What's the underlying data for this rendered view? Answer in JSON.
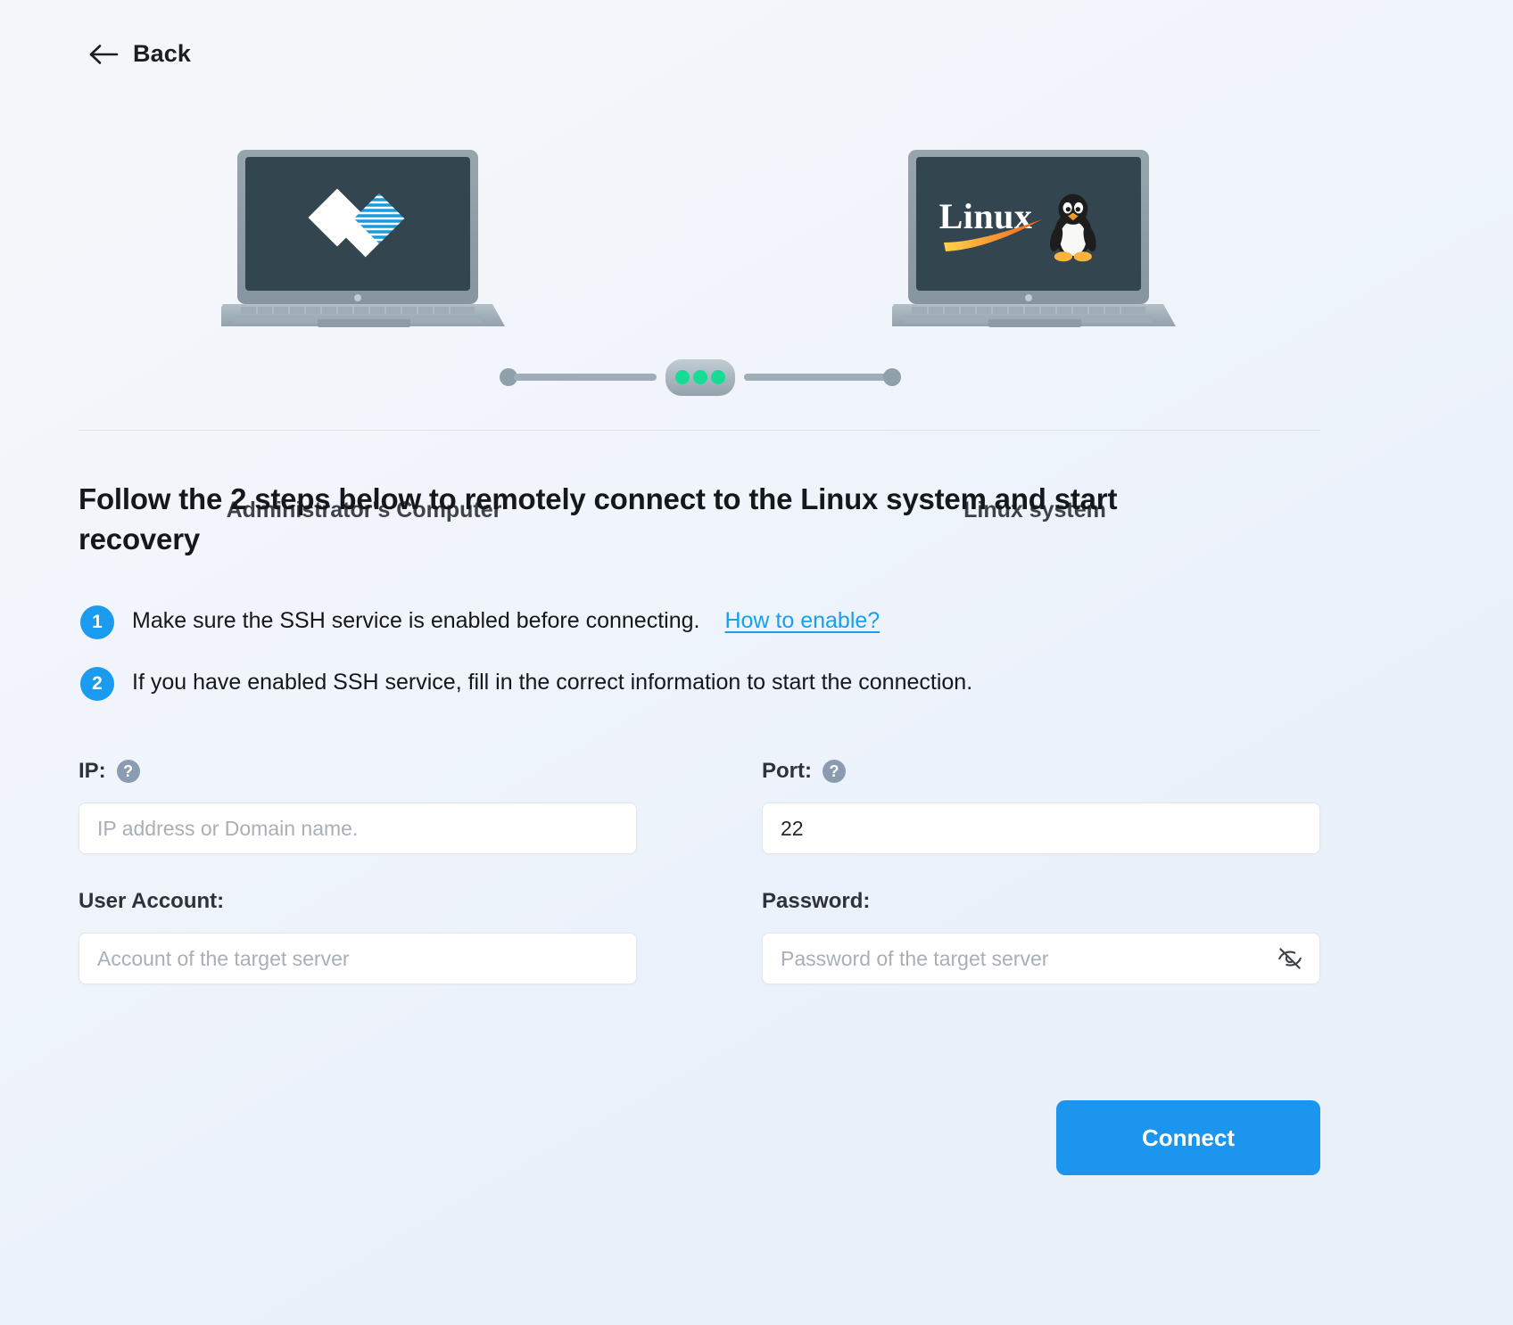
{
  "nav": {
    "back_label": "Back",
    "back_icon": "arrow-left-icon"
  },
  "illustration": {
    "left": {
      "caption": "Administrator's Computer",
      "screen_logo": "easeus-diamond-logo"
    },
    "right": {
      "caption": "Linux system",
      "screen_logo": "linux-tux-logo",
      "screen_logo_text": "Linux"
    },
    "connector": {
      "icon": "connection-status-pill",
      "dot_color": "#16dd93",
      "dots": 3
    }
  },
  "heading": "Follow the 2 steps below to remotely connect to the Linux system and start recovery",
  "steps": [
    {
      "number": "1",
      "text": "Make sure the SSH service is enabled before connecting.",
      "link": "How to enable?"
    },
    {
      "number": "2",
      "text": "If you have enabled SSH service, fill in the correct information to start the connection.",
      "link": ""
    }
  ],
  "form": {
    "ip": {
      "label": "IP:",
      "help_icon": "question-mark-icon",
      "value": "",
      "placeholder": "IP address or Domain name."
    },
    "port": {
      "label": "Port:",
      "help_icon": "question-mark-icon",
      "value": "22",
      "placeholder": "22"
    },
    "user_account": {
      "label": "User Account:",
      "value": "",
      "placeholder": "Account of the target server"
    },
    "password": {
      "label": "Password:",
      "value": "",
      "placeholder": "Password of the target server",
      "toggle_icon": "eye-off-icon"
    }
  },
  "actions": {
    "connect_label": "Connect"
  },
  "colors": {
    "accent": "#1b95ee",
    "link": "#15a0f0",
    "badge": "#1b9bf0",
    "status_dot": "#16dd93",
    "screen_bg": "#334455",
    "page_bg": "#f1f5fb"
  }
}
